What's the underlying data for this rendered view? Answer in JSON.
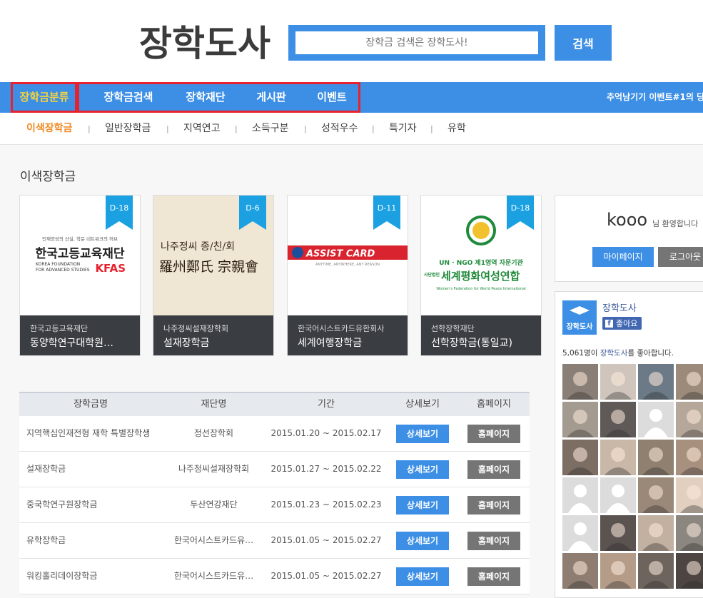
{
  "header": {
    "logo_text": "장학도사",
    "search_placeholder": "장학금 검색은 장학도사!",
    "search_button": "검색"
  },
  "nav": {
    "items": [
      "장학금분류",
      "장학금검색",
      "장학재단",
      "게시판",
      "이벤트"
    ],
    "ticker": "추억남기기 이벤트#1의 당"
  },
  "subnav": {
    "items": [
      "이색장학금",
      "일반장학금",
      "지역연고",
      "소득구분",
      "성적우수",
      "특기자",
      "유학"
    ],
    "separator": "|"
  },
  "section_title": "이색장학금",
  "cards": [
    {
      "badge": "D-18",
      "foundation": "한국고등교육재단",
      "name": "동양학연구대학원…",
      "img_small": "인재양성의 산실, 학문 네트워크의 허브",
      "img_main": "한국고등교육재단",
      "img_en1": "KOREA FOUNDATION",
      "img_en2": "FOR ADVANCED STUDIES",
      "img_mark": "KFAS"
    },
    {
      "badge": "D-6",
      "foundation": "나주정씨설재장학회",
      "name": "설재장학금",
      "img_line1": "나주정씨 종/친/회",
      "img_line2": "羅州鄭氏 宗親會"
    },
    {
      "badge": "D-11",
      "foundation": "한국어시스트카드유한회사",
      "name": "세계여행장학금",
      "img_main": "ASSIST CARD",
      "img_sub": "ANYTIME, ANYWHERE, ANY REASON"
    },
    {
      "badge": "D-18",
      "foundation": "선학장학재단",
      "name": "선학장학금(통일교)",
      "img_top": "UN · NGO 제1영역 자문기관",
      "img_side": "세계평화여성연합",
      "img_side_small": "사단법인",
      "img_en": "Women's Federation for World Peace International"
    }
  ],
  "table": {
    "headers": [
      "장학금명",
      "재단명",
      "기간",
      "상세보기",
      "홈페이지"
    ],
    "detail_label": "상세보기",
    "home_label": "홈페이지",
    "rows": [
      {
        "name": "지역핵심인재전형 재학 특별장학생",
        "foundation": "정선장학회",
        "period": "2015.01.20 ~ 2015.02.17"
      },
      {
        "name": "설재장학금",
        "foundation": "나주정씨설재장학회",
        "period": "2015.01.27 ~ 2015.02.22"
      },
      {
        "name": "중국학연구원장학금",
        "foundation": "두산연강재단",
        "period": "2015.01.23 ~ 2015.02.23"
      },
      {
        "name": "유학장학금",
        "foundation": "한국어시스트카드유…",
        "period": "2015.01.05 ~ 2015.02.27"
      },
      {
        "name": "워킹홀리데이장학금",
        "foundation": "한국어시스트카드유…",
        "period": "2015.01.05 ~ 2015.02.27"
      }
    ]
  },
  "login": {
    "username": "kooo",
    "welcome": "님 환영합니다",
    "mypage": "마이페이지",
    "logout": "로그아웃"
  },
  "facebook": {
    "page_name": "장학도사",
    "logo_text": "장학도사",
    "like_button": "좋아요",
    "like_count": "5,061명이",
    "like_page": "장학도사",
    "like_suffix": "를 좋아합니다."
  },
  "colors": {
    "primary": "#3d8fe6",
    "highlight": "#f7d43a",
    "active_sub": "#f08a24",
    "red_box": "#e8212e",
    "caption_bg": "#3a3d42"
  }
}
